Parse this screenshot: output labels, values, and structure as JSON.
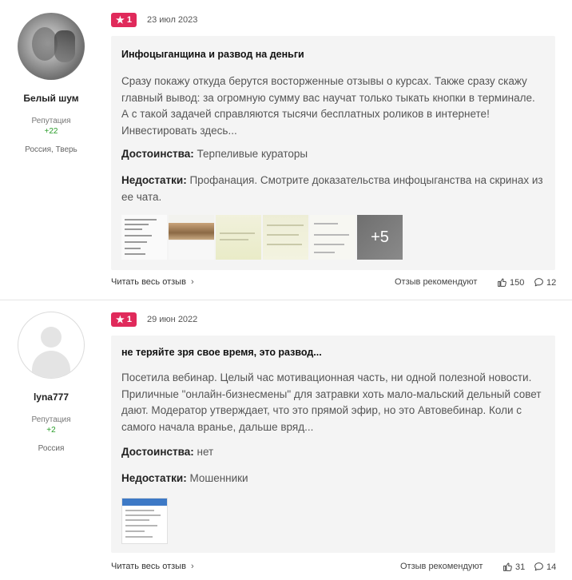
{
  "reviews": [
    {
      "user": {
        "name": "Белый шум",
        "rep_label": "Репутация",
        "rep_value": "+22",
        "location": "Россия, Тверь"
      },
      "rating": "1",
      "date": "23 июл 2023",
      "title": "Инфоцыганщина и развод на деньги",
      "text": "Сразу покажу откуда берутся восторженные отзывы о курсах. Также сразу скажу главный вывод: за огромную сумму вас научат только тыкать кнопки в терминале. А с такой задачей справляются тысячи бесплатных роликов в интернете! Инвестировать здесь...",
      "pros_label": "Достоинства:",
      "pros": "Терпеливые кураторы",
      "cons_label": "Недостатки:",
      "cons": "Профанация. Смотрите доказательства инфоцыганства на скринах из ее чата.",
      "more_photos": "+5",
      "read_all": "Читать весь отзыв",
      "recommends": "Отзыв рекомендуют",
      "likes": "150",
      "comments": "12"
    },
    {
      "user": {
        "name": "lyna777",
        "rep_label": "Репутация",
        "rep_value": "+2",
        "location": "Россия"
      },
      "rating": "1",
      "date": "29 июн 2022",
      "title": "не теряйте зря свое время, это развод...",
      "text": "Посетила вебинар. Целый час мотивационная часть, ни одной полезной новости. Приличные \"онлайн-бизнесмены\" для затравки хоть мало-мальский дельный совет дают. Модератор утверждает, что это прямой эфир, но это Автовебинар. Коли с самого начала вранье, дальше вряд...",
      "pros_label": "Достоинства:",
      "pros": "нет",
      "cons_label": "Недостатки:",
      "cons": "Мошенники",
      "read_all": "Читать весь отзыв",
      "recommends": "Отзыв рекомендуют",
      "likes": "31",
      "comments": "14"
    }
  ],
  "icons": {
    "star": "star-icon",
    "like": "thumbs-up-icon",
    "comment": "comment-bubble-icon",
    "chevron": "chevron-right-icon"
  },
  "colors": {
    "badge": "#e02a5b",
    "reputation": "#2a9d2a",
    "card": "#f4f4f4"
  }
}
